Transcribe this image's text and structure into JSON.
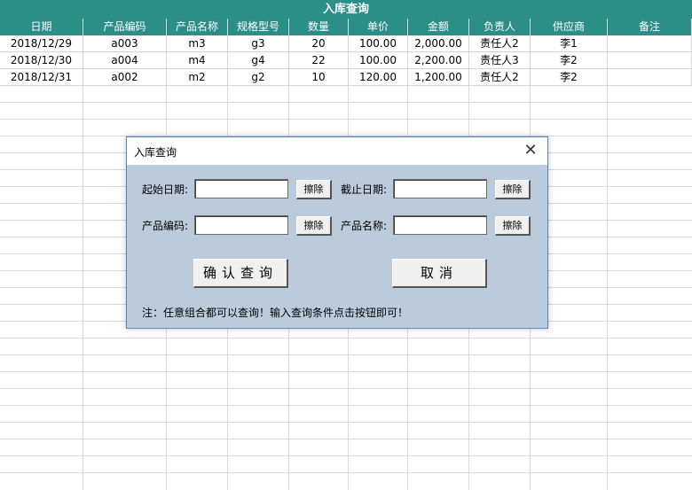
{
  "sheet": {
    "title": "入库查询",
    "columns": [
      "日期",
      "产品编码",
      "产品名称",
      "规格型号",
      "数量",
      "单价",
      "金额",
      "负责人",
      "供应商",
      "备注"
    ],
    "rows": [
      [
        "2018/12/29",
        "a003",
        "m3",
        "g3",
        "20",
        "100.00",
        "2,000.00",
        "责任人2",
        "李1",
        ""
      ],
      [
        "2018/12/30",
        "a004",
        "m4",
        "g4",
        "22",
        "100.00",
        "2,200.00",
        "责任人3",
        "李2",
        ""
      ],
      [
        "2018/12/31",
        "a002",
        "m2",
        "g2",
        "10",
        "120.00",
        "1,200.00",
        "责任人2",
        "李2",
        ""
      ]
    ]
  },
  "dialog": {
    "title": "入库查询",
    "close_symbol": "✕",
    "start_date_label": "起始日期:",
    "end_date_label": "截止日期:",
    "product_code_label": "产品编码:",
    "product_name_label": "产品名称:",
    "start_date_value": "",
    "end_date_value": "",
    "product_code_value": "",
    "product_name_value": "",
    "clear_label": "擦除",
    "confirm_label": "确认查询",
    "cancel_label": "取消",
    "note": "注：任意组合都可以查询！输入查询条件点击按钮即可！"
  }
}
